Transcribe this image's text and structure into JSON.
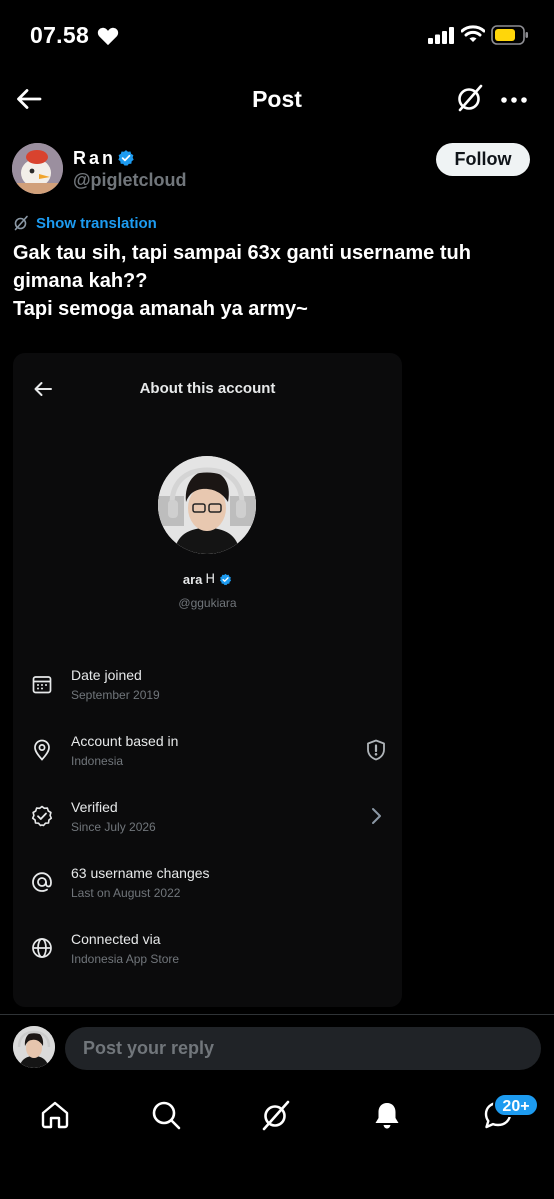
{
  "status_bar": {
    "time": "07.58"
  },
  "nav": {
    "title": "Post"
  },
  "author": {
    "name": "Ran",
    "handle": "@pigletcloud"
  },
  "follow_label": "Follow",
  "translation": {
    "label": "Show translation"
  },
  "post": {
    "lines": [
      "Gak tau sih, tapi sampai 63x ganti username tuh",
      "gimana kah??",
      "Tapi semoga amanah ya army~"
    ]
  },
  "embed": {
    "title": "About this account",
    "name": "ara",
    "name_glyph": "ᕼ",
    "handle": "@ggukiara",
    "rows": [
      {
        "icon": "calendar-icon",
        "title": "Date joined",
        "sub": "September 2019"
      },
      {
        "icon": "location-pin-icon",
        "title": "Account based in",
        "sub": "Indonesia"
      },
      {
        "icon": "verified-check-icon",
        "title": "Verified",
        "sub": "Since July 2026"
      },
      {
        "icon": "at-sign-icon",
        "title": "63 username changes",
        "sub": "Last on August 2022"
      },
      {
        "icon": "globe-icon",
        "title": "Connected via",
        "sub": "Indonesia App Store"
      }
    ]
  },
  "reply": {
    "placeholder": "Post your reply"
  },
  "bottom_nav": {
    "tabs": [
      "home-icon",
      "search-icon",
      "grok-icon",
      "notifications-icon",
      "messages-icon"
    ],
    "badge": "20+"
  },
  "colors": {
    "accent": "#1d9bf0",
    "background": "#000000",
    "muted": "#71767b",
    "battery": "#ffd60a"
  }
}
